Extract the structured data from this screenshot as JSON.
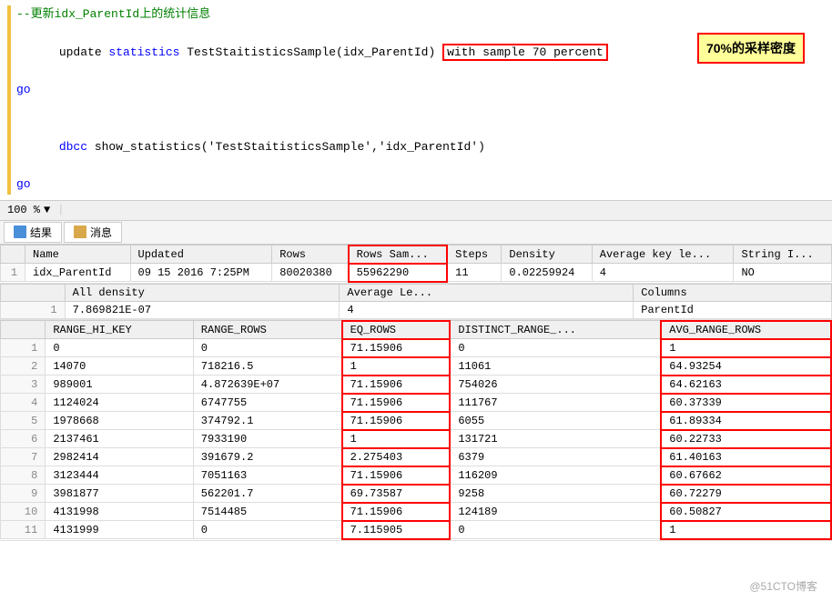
{
  "code": {
    "comment1": "--更新idx_ParentId上的统计信息",
    "line2_pre": "update ",
    "line2_kw1": "statistics",
    "line2_mid": " TestStaitisticsSample(idx_ParentId) ",
    "line2_highlight": "with sample 70 percent",
    "line3": "go",
    "line4": "",
    "line5_kw": "dbcc",
    "line5_rest": " show_statistics('TestStaitisticsSample','idx_ParentId')",
    "line6": "go",
    "annotation": "70%的采样密度"
  },
  "zoom": {
    "level": "100 %"
  },
  "tabs": [
    {
      "label": "结果",
      "type": "results"
    },
    {
      "label": "消息",
      "type": "messages"
    }
  ],
  "table1": {
    "headers": [
      "Name",
      "Updated",
      "Rows",
      "Rows Sam...",
      "Steps",
      "Density",
      "Average key le...",
      "String I..."
    ],
    "rows": [
      [
        "idx_ParentId",
        "09 15 2016  7:25PM",
        "80020380",
        "55962290",
        "11",
        "0.02259924",
        "4",
        "NO"
      ]
    ]
  },
  "table2": {
    "headers": [
      "All density",
      "Average Le...",
      "Columns"
    ],
    "rows": [
      [
        "7.869821E-07",
        "4",
        "ParentId"
      ]
    ]
  },
  "table3": {
    "headers": [
      "RANGE_HI_KEY",
      "RANGE_ROWS",
      "EQ_ROWS",
      "DISTINCT_RANGE_...",
      "AVG_RANGE_ROWS"
    ],
    "rows": [
      [
        "0",
        "0",
        "71.15906",
        "0",
        "1"
      ],
      [
        "14070",
        "718216.5",
        "1",
        "11061",
        "64.93254"
      ],
      [
        "989001",
        "4.872639E+07",
        "71.15906",
        "754026",
        "64.62163"
      ],
      [
        "1124024",
        "6747755",
        "71.15906",
        "111767",
        "60.37339"
      ],
      [
        "1978668",
        "374792.1",
        "71.15906",
        "6055",
        "61.89334"
      ],
      [
        "2137461",
        "7933190",
        "1",
        "131721",
        "60.22733"
      ],
      [
        "2982414",
        "391679.2",
        "2.275403",
        "6379",
        "61.40163"
      ],
      [
        "3123444",
        "7051163",
        "71.15906",
        "116209",
        "60.67662"
      ],
      [
        "3981877",
        "562201.7",
        "69.73587",
        "9258",
        "60.72279"
      ],
      [
        "4131998",
        "7514485",
        "71.15906",
        "124189",
        "60.50827"
      ],
      [
        "4131999",
        "0",
        "7.115905",
        "0",
        "1"
      ]
    ]
  },
  "watermark": "@51CTO博客"
}
